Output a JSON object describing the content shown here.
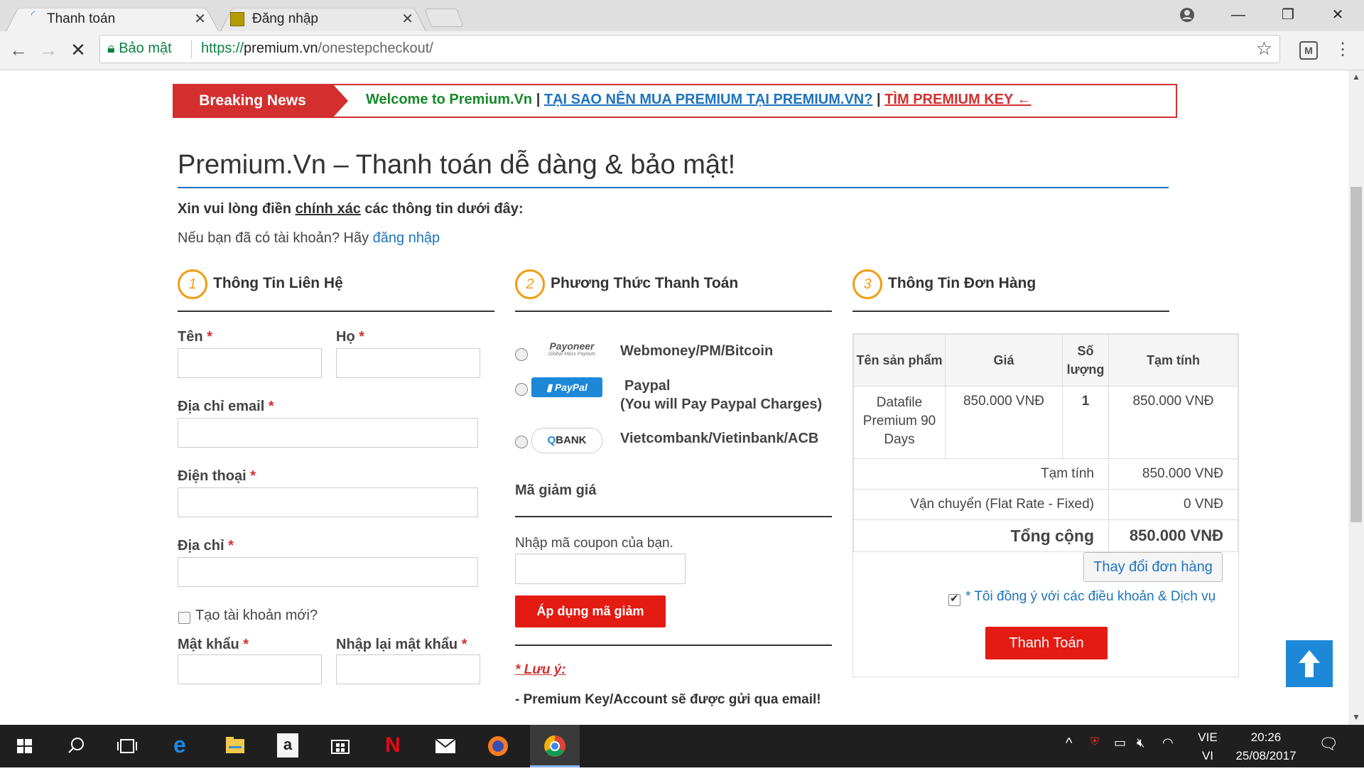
{
  "browser": {
    "tabs": [
      {
        "title": "Thanh toán",
        "active": true
      },
      {
        "title": "Đăng nhập",
        "active": false
      }
    ],
    "secure_label": "Bảo mật",
    "url_scheme": "https://",
    "url_host": "premium.vn",
    "url_path": "/onestepcheckout/"
  },
  "news": {
    "label": "Breaking News",
    "welcome": "Welcome to Premium.Vn",
    "sep1": "|",
    "link1": "TẠI SAO NÊN MUA PREMIUM TẠI PREMIUM.VN?",
    "sep2": "|",
    "link2": "TÌM PREMIUM KEY ←"
  },
  "page": {
    "title": "Premium.Vn – Thanh toán dễ dàng & bảo mật!",
    "intro_pre": "Xin vui lòng điền ",
    "intro_em": "chính xác",
    "intro_post": " các thông tin dưới đây:",
    "login_prompt": "Nếu bạn đã có tài khoản? Hãy ",
    "login_link": "đăng nhập"
  },
  "contact": {
    "num": "1",
    "heading": "Thông Tin Liên Hệ",
    "first_name": "Tên",
    "last_name": "Họ",
    "email": "Địa chỉ email",
    "phone": "Điện thoại",
    "address": "Địa chỉ",
    "create_account": "Tạo tài khoản mới?",
    "password": "Mật khẩu",
    "password_confirm": "Nhập lại mật khẩu",
    "required_mark": "*"
  },
  "payment": {
    "num": "2",
    "heading": "Phương Thức Thanh Toán",
    "methods": [
      {
        "logo": "Payoneer",
        "logo_sub": "Global Mass Payouts",
        "name": "Webmoney/PM/Bitcoin"
      },
      {
        "logo": "PayPal",
        "name": "Paypal",
        "note": "(You will Pay Paypal Charges)"
      },
      {
        "logo": "BANK",
        "name": "Vietcombank/Vietinbank/ACB"
      }
    ],
    "coupon_heading": "Mã giảm giá",
    "coupon_label": "Nhập mã coupon của bạn.",
    "coupon_button": "Áp dụng mã giảm",
    "note_title": "* Lưu ý:",
    "note_text": "- Premium Key/Account sẽ được gửi qua email!"
  },
  "order": {
    "num": "3",
    "heading": "Thông Tin Đơn Hàng",
    "columns": [
      "Tên sản phẩm",
      "Giá",
      "Số lượng",
      "Tạm tính"
    ],
    "items": [
      {
        "name": "Datafile Premium 90 Days",
        "price": "850.000 VNĐ",
        "qty": "1",
        "subtotal": "850.000 VNĐ"
      }
    ],
    "subtotal_label": "Tạm tính",
    "subtotal_value": "850.000 VNĐ",
    "shipping_label": "Vận chuyển (Flat Rate - Fixed)",
    "shipping_value": "0 VNĐ",
    "total_label": "Tổng cộng",
    "total_value": "850.000 VNĐ",
    "change_button": "Thay đổi đơn hàng",
    "terms": "* Tôi đồng ý với các điều khoản & Dịch vụ",
    "terms_checked": true,
    "checkout_button": "Thanh Toán"
  },
  "taskbar": {
    "lang_top": "VIE",
    "lang_bottom": "VI",
    "time": "20:26",
    "date": "25/08/2017"
  },
  "colors": {
    "accent_red": "#e31b12",
    "link_blue": "#1e73be",
    "step_orange": "#f39c12",
    "news_green": "#168a29"
  }
}
